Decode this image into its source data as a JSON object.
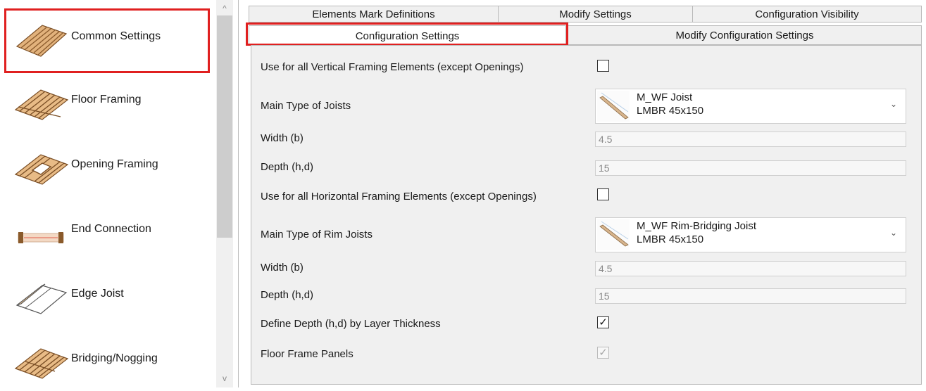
{
  "sidebar": {
    "items": [
      {
        "label": "Common Settings",
        "icon": "common-settings-icon"
      },
      {
        "label": "Floor Framing",
        "icon": "floor-framing-icon"
      },
      {
        "label": "Opening Framing",
        "icon": "opening-framing-icon"
      },
      {
        "label": "End Connection",
        "icon": "end-connection-icon"
      },
      {
        "label": "Edge Joist",
        "icon": "edge-joist-icon"
      },
      {
        "label": "Bridging/Nogging",
        "icon": "bridging-nogging-icon"
      }
    ],
    "selected": "Common Settings",
    "scroll_up": "^",
    "scroll_down": "v"
  },
  "tabs": {
    "row1": [
      "Elements Mark Definitions",
      "Modify Settings",
      "Configuration Visibility"
    ],
    "row2": [
      "Configuration Settings",
      "Modify Configuration Settings"
    ],
    "active": "Configuration Settings"
  },
  "form": {
    "vertical_all_label": "Use for all Vertical Framing Elements (except Openings)",
    "vertical_all_checked": false,
    "main_joist_label": "Main Type of Joists",
    "main_joist": {
      "family": "M_WF Joist",
      "type": "LMBR 45x150"
    },
    "width1_label": "Width (b)",
    "width1_value": "4.5",
    "depth1_label": "Depth (h,d)",
    "depth1_value": "15",
    "horizontal_all_label": "Use for all Horizontal Framing Elements (except Openings)",
    "horizontal_all_checked": false,
    "rim_joist_label": "Main Type of Rim Joists",
    "rim_joist": {
      "family": "M_WF Rim-Bridging Joist",
      "type": "LMBR 45x150"
    },
    "width2_label": "Width (b)",
    "width2_value": "4.5",
    "depth2_label": "Depth (h,d)",
    "depth2_value": "15",
    "depth_by_layer_label": "Define Depth (h,d) by Layer Thickness",
    "depth_by_layer_checked": true,
    "floor_panels_label": "Floor Frame Panels",
    "floor_panels_checked": true,
    "check_mark": "✓",
    "dropdown_chevron": "⌄"
  },
  "colors": {
    "highlight": "#e02020",
    "panel_bg": "#f0f0f0",
    "wood": "#c9925a",
    "wood_dark": "#7a4e25"
  }
}
